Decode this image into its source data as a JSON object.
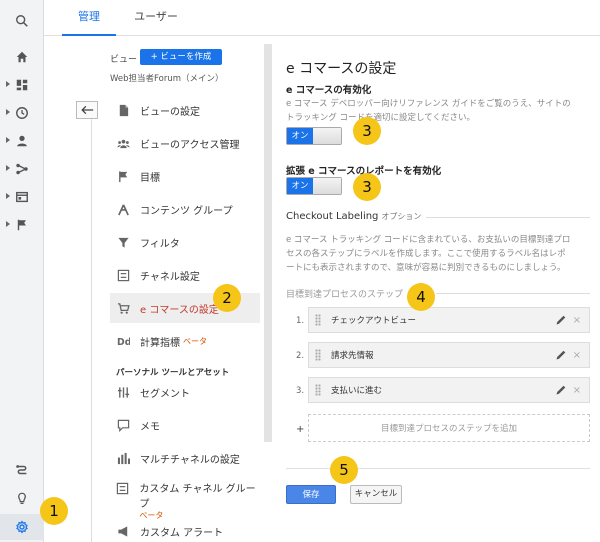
{
  "tabs": [
    {
      "label": "管理",
      "active": true
    },
    {
      "label": "ユーザー",
      "active": false
    }
  ],
  "rail_icons": [
    "search-icon",
    "home-icon",
    "dashboard-icon",
    "clock-icon",
    "person-icon",
    "flow-icon",
    "window-icon",
    "flag-icon",
    "discover-icon",
    "lightbulb-icon",
    "gear-icon"
  ],
  "view": {
    "label": "ビュー",
    "create_button": "+ ビューを作成",
    "name": "Web担当者Forum（メイン）"
  },
  "menu": {
    "items": [
      {
        "label": "ビューの設定",
        "icon": "document-icon"
      },
      {
        "label": "ビューのアクセス管理",
        "icon": "people-icon"
      },
      {
        "label": "目標",
        "icon": "flag-icon"
      },
      {
        "label": "コンテンツ グループ",
        "icon": "person-walk-icon"
      },
      {
        "label": "フィルタ",
        "icon": "filter-icon"
      },
      {
        "label": "チャネル設定",
        "icon": "channel-icon"
      },
      {
        "label": "e コマースの設定",
        "icon": "cart-icon",
        "selected": true
      },
      {
        "label": "計算指標",
        "icon": "dd-icon",
        "beta": "ベータ"
      }
    ],
    "section_title": "パーソナル ツールとアセット",
    "personal_items": [
      {
        "label": "セグメント",
        "icon": "segment-icon"
      },
      {
        "label": "メモ",
        "icon": "note-icon"
      },
      {
        "label": "マルチチャネルの設定",
        "icon": "bars-icon"
      },
      {
        "label": "カスタム チャネル グループ",
        "icon": "channel-icon",
        "beta": "ベータ"
      },
      {
        "label": "カスタム アラート",
        "icon": "megaphone-icon"
      }
    ]
  },
  "main": {
    "title": "e コマースの設定",
    "enable_ecommerce": {
      "heading": "e コマースの有効化",
      "desc1": "e コマース デベロッパー向けリファレンス ガイドをご覧のうえ、サイトの",
      "desc2": "トラッキング コードを適切に設定してください。",
      "toggle_label": "オン"
    },
    "enable_enhanced": {
      "heading": "拡張 e コマースのレポートを有効化",
      "toggle_label": "オン"
    },
    "checkout_labeling": {
      "title": "Checkout Labeling",
      "subtitle": "オプション",
      "desc1": "e コマース トラッキング コードに含まれている、お支払いの目標到達プロ",
      "desc2": "セスの各ステップにラベルを作成します。ここで使用するラベル名はレポ",
      "desc3": "ートにも表示されますので、意味が容易に判別できるものにしましょう。"
    },
    "steps_title": "目標到達プロセスのステップ",
    "steps": [
      {
        "num": "1.",
        "label": "チェックアウトビュー"
      },
      {
        "num": "2.",
        "label": "請求先情報"
      },
      {
        "num": "3.",
        "label": "支払いに進む"
      }
    ],
    "add_plus": "+",
    "add_step": "目標到達プロセスのステップを追加",
    "save_label": "保存",
    "cancel_label": "キャンセル"
  },
  "badges": [
    "1",
    "2",
    "3",
    "3",
    "4",
    "5"
  ],
  "colors": {
    "accent": "#1a73e8",
    "selected_text": "#c0392b",
    "badge": "#f5c518",
    "beta": "#d35400"
  }
}
